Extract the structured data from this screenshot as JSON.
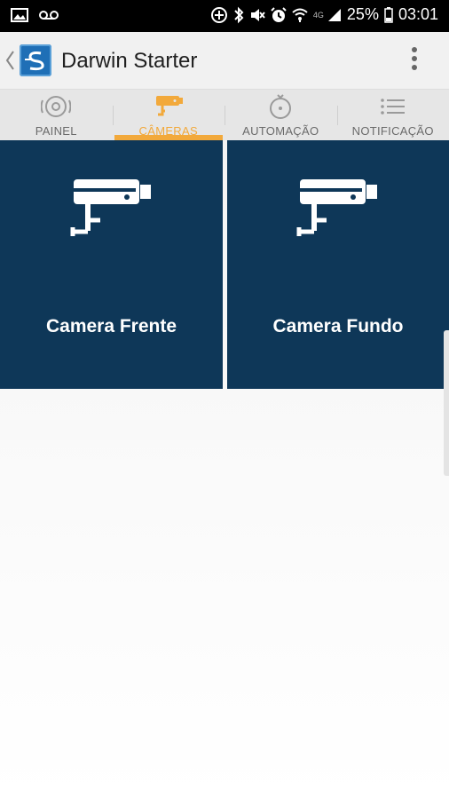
{
  "status_bar": {
    "battery": "25%",
    "time": "03:01",
    "network": "4G",
    "icons": [
      "image-icon",
      "voicemail-icon",
      "data-saver-icon",
      "bluetooth-icon",
      "mute-icon",
      "alarm-icon",
      "wifi-icon",
      "signal-icon",
      "battery-icon"
    ]
  },
  "app_bar": {
    "title": "Darwin Starter",
    "icons": [
      "back-chevron-icon",
      "app-logo-icon",
      "overflow-menu-icon"
    ]
  },
  "tabs": [
    {
      "label": "PAINEL",
      "icon": "radio-target-icon",
      "active": false
    },
    {
      "label": "CÂMERAS",
      "icon": "security-camera-icon",
      "active": true
    },
    {
      "label": "AUTOMAÇÃO",
      "icon": "timer-icon",
      "active": false
    },
    {
      "label": "NOTIFICAÇÃO",
      "icon": "list-icon",
      "active": false
    }
  ],
  "cameras": [
    {
      "label": "Camera Frente",
      "icon": "security-camera-icon"
    },
    {
      "label": "Camera Fundo",
      "icon": "security-camera-icon"
    }
  ],
  "colors": {
    "accent": "#f2a93b",
    "tile_background": "#0e3758",
    "status_bar": "#000000",
    "app_bar": "#f1f1f1",
    "tab_bar": "#e6e6e6"
  }
}
